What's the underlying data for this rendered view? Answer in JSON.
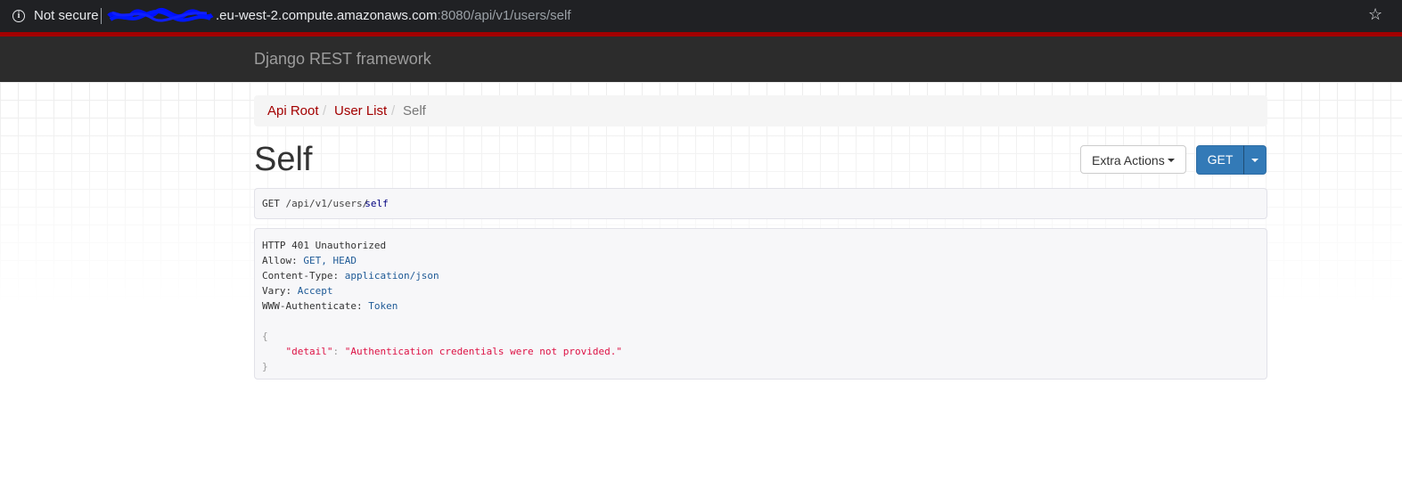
{
  "browser": {
    "security_label": "Not secure",
    "url_host": ".eu-west-2.compute.amazonaws.com",
    "url_path": ":8080/api/v1/users/self",
    "icons": {
      "info": "info-icon",
      "bookmark": "star-icon"
    }
  },
  "navbar": {
    "brand": "Django REST framework"
  },
  "breadcrumb": {
    "items": [
      {
        "label": "Api Root"
      },
      {
        "label": "User List"
      },
      {
        "label": "Self"
      }
    ],
    "separator": "/"
  },
  "page": {
    "title": "Self"
  },
  "buttons": {
    "extra_actions": "Extra Actions",
    "get": "GET"
  },
  "request": {
    "method": "GET",
    "path": "/api/v1/users/",
    "path_end": "self"
  },
  "response": {
    "status": "HTTP 401 Unauthorized",
    "headers": [
      {
        "name": "Allow:",
        "value": "GET, HEAD"
      },
      {
        "name": "Content-Type:",
        "value": "application/json"
      },
      {
        "name": "Vary:",
        "value": "Accept"
      },
      {
        "name": "WWW-Authenticate:",
        "value": "Token"
      }
    ],
    "body_open": "{",
    "body_key": "\"detail\"",
    "body_colon": ": ",
    "body_value": "\"Authentication credentials were not provided.\"",
    "body_close": "}"
  },
  "colors": {
    "accent": "#a30000",
    "primary": "#337ab7",
    "navbar": "#2c2c2c"
  }
}
